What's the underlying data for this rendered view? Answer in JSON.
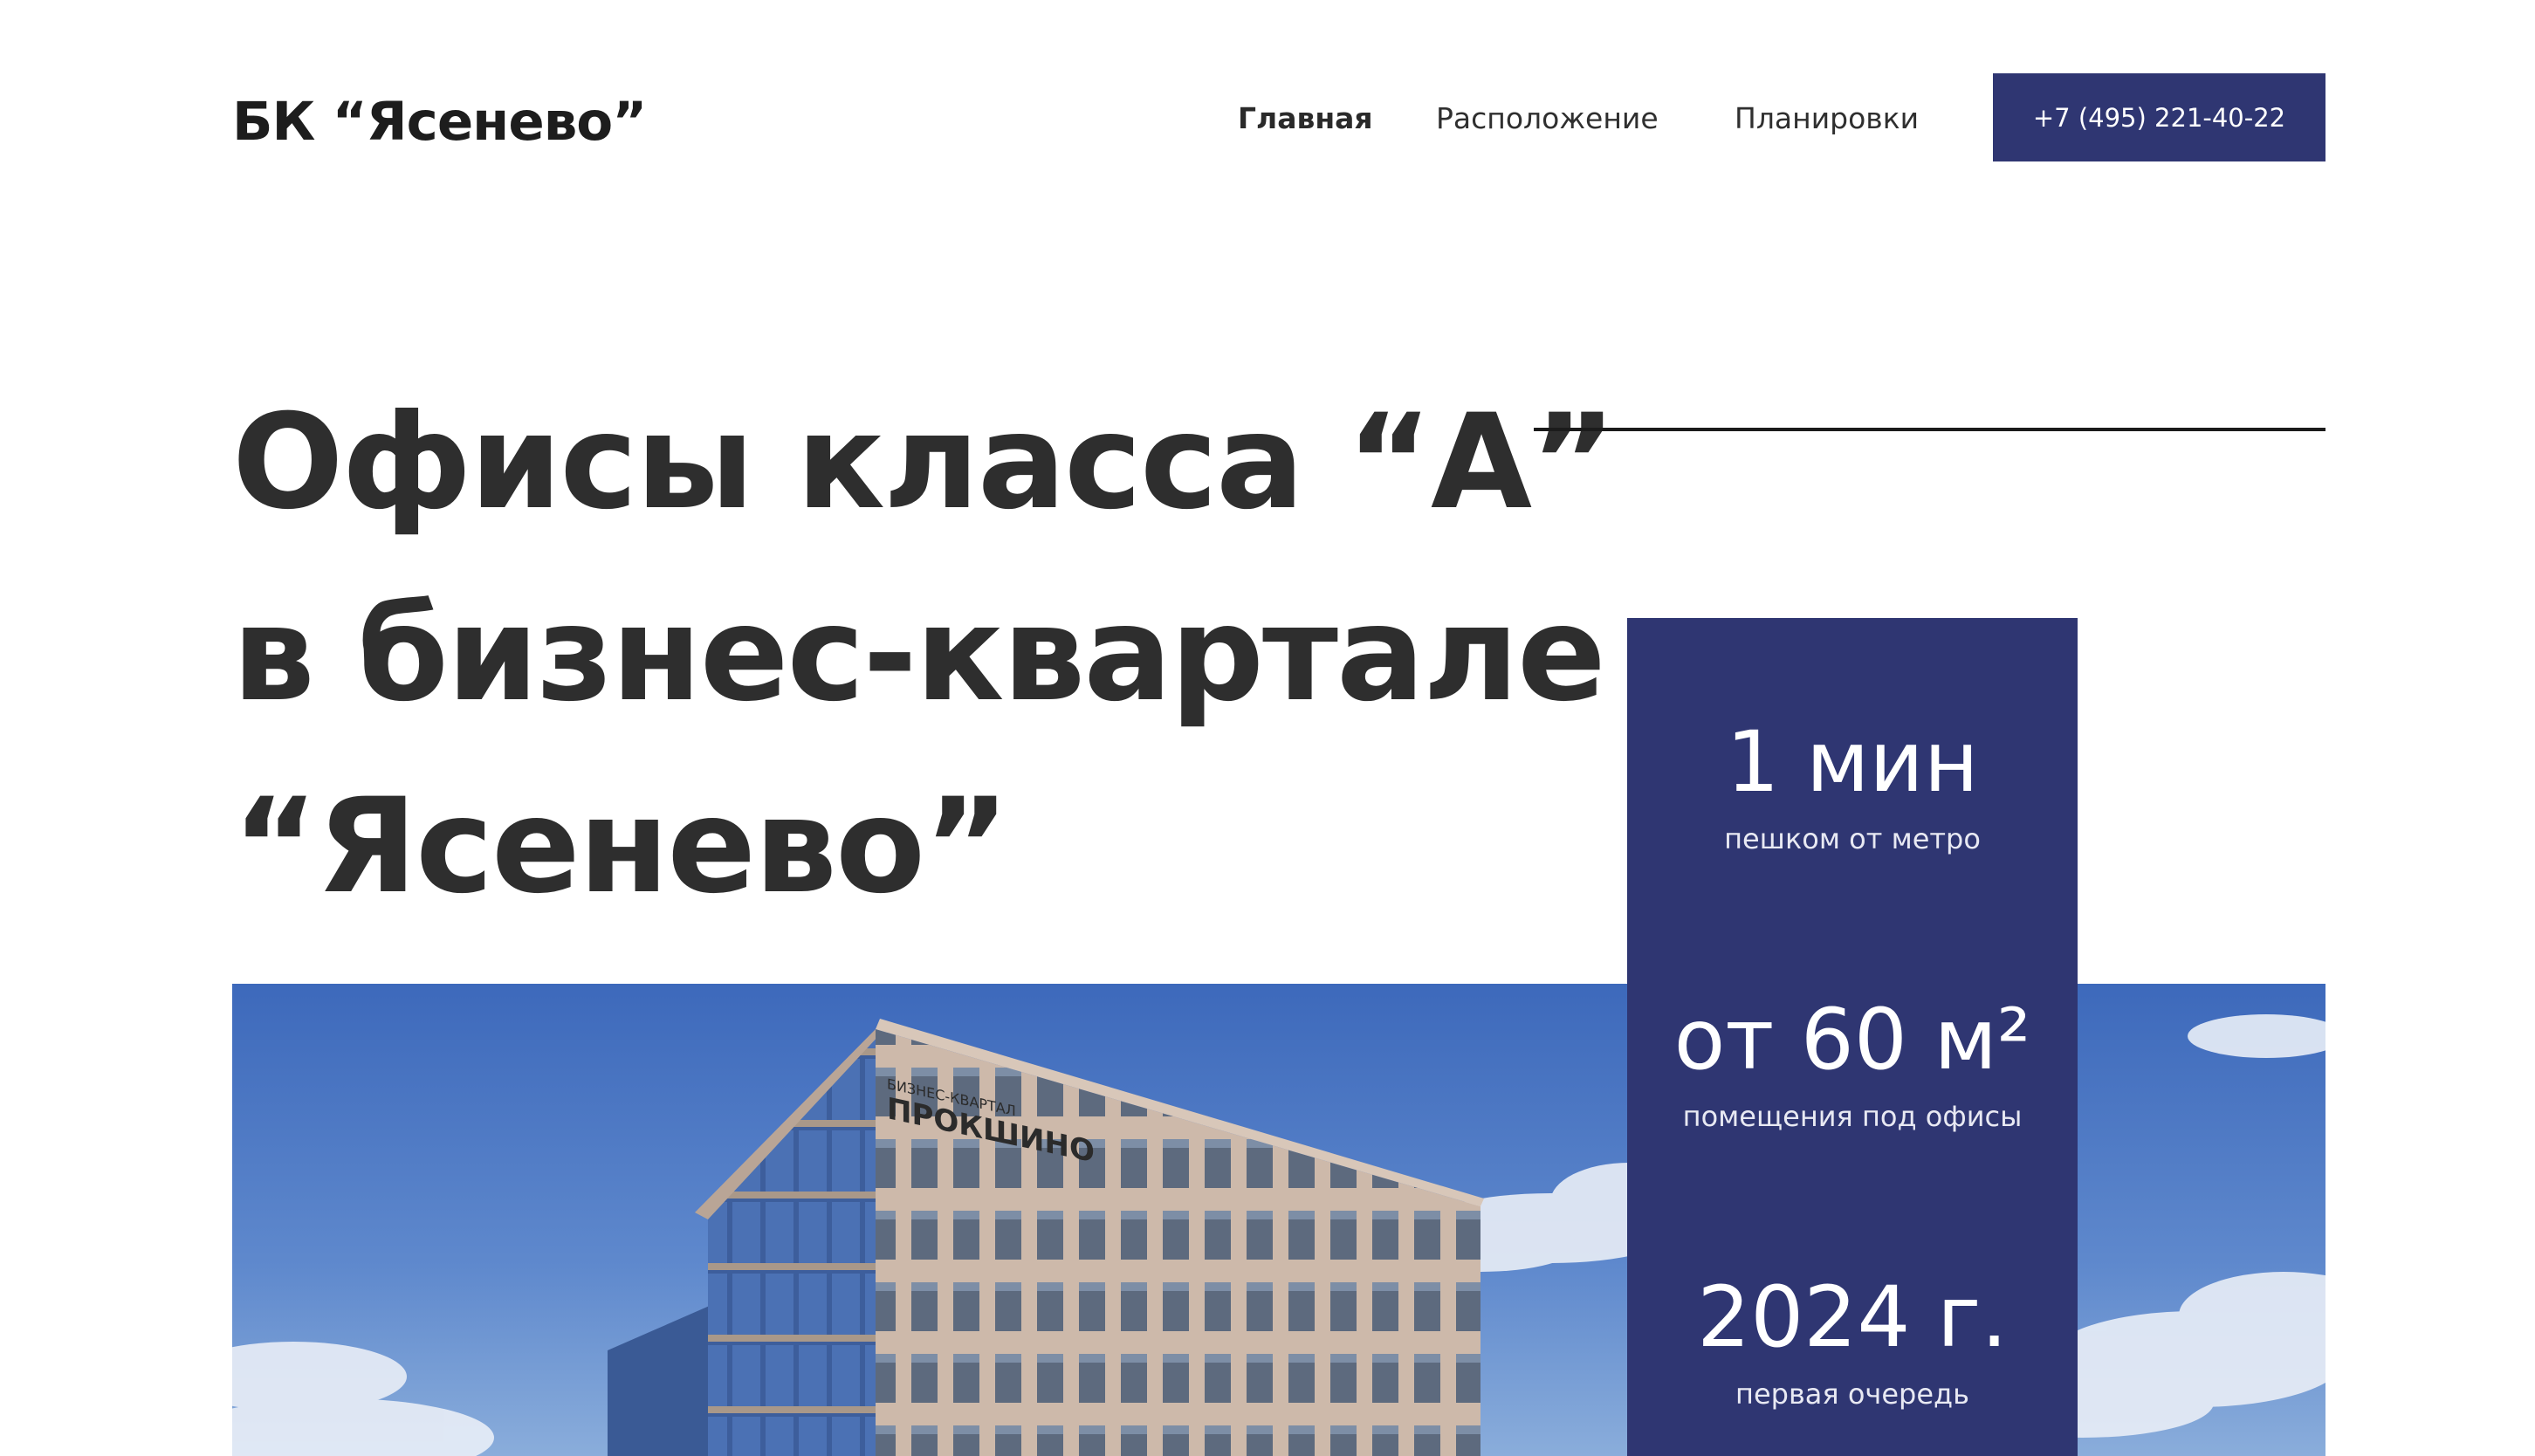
{
  "header": {
    "logo": "БК “Ясенево”",
    "nav": [
      {
        "label": "Главная",
        "active": true
      },
      {
        "label": "Расположение",
        "active": false
      },
      {
        "label": "Планировки",
        "active": false
      }
    ],
    "phone": "+7 (495) 221-40-22"
  },
  "hero": {
    "title_lines": [
      "Офисы класса “А”",
      "в бизнес-квартале",
      "“Ясенево”"
    ]
  },
  "stats": [
    {
      "value": "1 мин",
      "caption": "пешком от метро"
    },
    {
      "value": "от 60 м²",
      "caption": "помещения под офисы"
    },
    {
      "value": "2024 г.",
      "caption": "первая очередь"
    }
  ],
  "photo": {
    "building_sign": [
      "БИЗНЕС-КВАРТАЛ",
      "ПРОКШИНО"
    ]
  },
  "colors": {
    "accent": "#2f3672",
    "text": "#2f2f2f",
    "sky": "#4f7cc6"
  }
}
